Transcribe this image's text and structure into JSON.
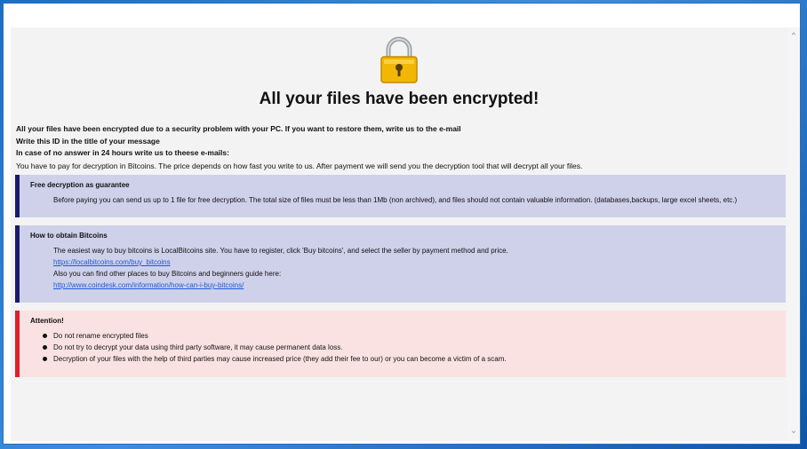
{
  "header": {
    "title": "All your files have been encrypted!"
  },
  "intro": {
    "line1": "All your files have been encrypted due to a security problem with your PC. If you want to restore them, write us to the e-mail",
    "line2": "Write this ID in the title of your message",
    "line3": "In case of no answer in 24 hours write us to theese e-mails:",
    "line4": "You have to pay for decryption in Bitcoins. The price depends on how fast you write to us. After payment we will send you the decryption tool that will decrypt all your files."
  },
  "free_decryption": {
    "heading": "Free decryption as guarantee",
    "text": "Before paying you can send us up to 1 file for free decryption. The total size of files must be less than 1Mb (non archived), and files should not contain valuable information. (databases,backups, large excel sheets, etc.)"
  },
  "bitcoins": {
    "heading": "How to obtain Bitcoins",
    "text1": "The easiest way to buy bitcoins is LocalBitcoins site. You have to register, click 'Buy bitcoins', and select the seller by payment method and price.",
    "link1": "https://localbitcoins.com/buy_bitcoins",
    "text2": "Also you can find other places to buy Bitcoins and beginners guide here:",
    "link2": "http://www.coindesk.com/information/how-can-i-buy-bitcoins/"
  },
  "attention": {
    "heading": "Attention!",
    "items": [
      "Do not rename encrypted files",
      "Do not try to decrypt your data using third party software, it may cause permanent data loss.",
      "Decryption of your files with the help of third parties may cause increased price (they add their fee to our) or you can become a victim of a scam."
    ]
  },
  "colors": {
    "guarantee_bg": "#cfd0ea",
    "guarantee_bar": "#1a1a6e",
    "attention_bg": "#fbe2e2",
    "attention_bar": "#e0202a",
    "lock": "#f2b705"
  },
  "icons": {
    "lock": "padlock-icon"
  }
}
